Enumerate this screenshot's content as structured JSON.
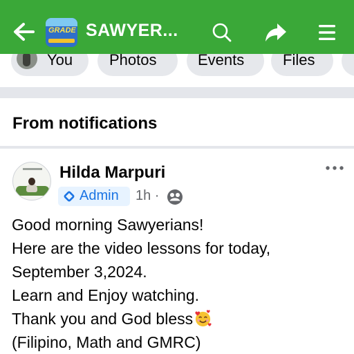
{
  "header": {
    "group_title": "SAWYER...",
    "group_avatar_text": "GRADE"
  },
  "chips": [
    {
      "label": "You"
    },
    {
      "label": "Photos"
    },
    {
      "label": "Events"
    },
    {
      "label": "Files"
    }
  ],
  "section": {
    "title": "From notifications"
  },
  "post": {
    "author": "Hilda Marpuri",
    "role_badge": "Admin",
    "time": "1h ·",
    "lines": [
      "Good morning Sawyerians!",
      "Here are the video lessons for today,",
      "September 3,2024.",
      "Learn and Enjoy watching.",
      "Thank you and God bless",
      "(Filipino, Math and GMRC)"
    ],
    "emoji": "smiling-face-with-hearts"
  },
  "colors": {
    "header_bg": "#3aa838",
    "chip_bg": "#e6e8ec",
    "admin_badge_bg": "#e7f3ff",
    "admin_blue": "#1b74e4",
    "secondary_text": "#65676b"
  },
  "icons": {
    "back": "back-arrow-icon",
    "search": "search-icon",
    "share": "share-icon",
    "menu": "menu-icon",
    "admin": "admin-diamond-icon",
    "privacy": "globe-icon",
    "more": "more-options-icon"
  }
}
